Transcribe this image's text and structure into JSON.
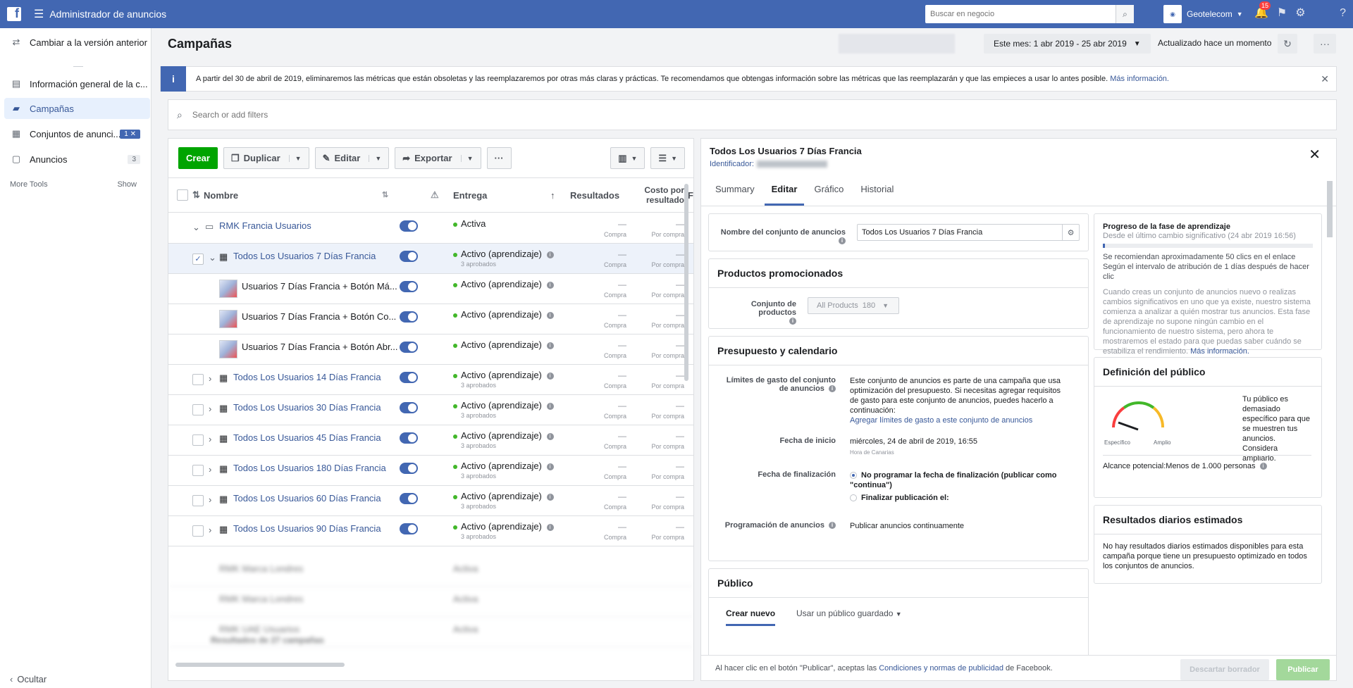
{
  "topbar": {
    "logo": "f",
    "title": "Administrador de anuncios",
    "search_placeholder": "Buscar en negocio",
    "account_name": "Geotelecom",
    "notification_count": "15"
  },
  "sidebar": {
    "items": [
      {
        "label": "Cambiar a la versión anterior",
        "icon": "swap-icon"
      },
      {
        "label": "Información general de la c...",
        "icon": "overview-icon"
      },
      {
        "label": "Campañas",
        "icon": "folder-icon"
      },
      {
        "label": "Conjuntos de anunci...",
        "icon": "grid-icon",
        "count": "1 ✕"
      },
      {
        "label": "Anuncios",
        "icon": "ad-icon",
        "count": "3"
      }
    ],
    "more_tools": "More Tools",
    "show": "Show",
    "hide": "Ocultar"
  },
  "header": {
    "title": "Campañas",
    "date_range": "Este mes: 1 abr 2019 - 25 abr 2019",
    "updated": "Actualizado hace un momento"
  },
  "notice": {
    "text": "A partir del 30 de abril de 2019, eliminaremos las métricas que están obsoletas y las reemplazaremos por otras más claras y prácticas. Te recomendamos que obtengas información sobre las métricas que las reemplazarán y que las empieces a usar lo antes posible.",
    "link": "Más información."
  },
  "filter": {
    "placeholder": "Search or add filters"
  },
  "toolbar": {
    "create": "Crear",
    "duplicate": "Duplicar",
    "edit": "Editar",
    "export": "Exportar",
    "more": "···"
  },
  "table": {
    "headers": {
      "name": "Nombre",
      "delivery": "Entrega",
      "results": "Resultados",
      "cost": "Costo por resultado",
      "extra": "F"
    },
    "result_label": "Compra",
    "cost_label": "Por compra",
    "dash": "—",
    "rows": [
      {
        "name": "RMK Francia Usuarios",
        "status": "Activa",
        "sub": "",
        "kind": "campaign"
      },
      {
        "name": "Todos Los Usuarios 7 Días Francia",
        "status": "Activo (aprendizaje)",
        "sub": "3 aprobados",
        "kind": "adset"
      },
      {
        "name": "Usuarios 7 Días Francia + Botón Má...",
        "status": "Activo (aprendizaje)",
        "sub": "",
        "kind": "ad"
      },
      {
        "name": "Usuarios 7 Días Francia + Botón Co...",
        "status": "Activo (aprendizaje)",
        "sub": "",
        "kind": "ad"
      },
      {
        "name": "Usuarios 7 Días Francia + Botón Abr...",
        "status": "Activo (aprendizaje)",
        "sub": "",
        "kind": "ad"
      },
      {
        "name": "Todos Los Usuarios 14 Días Francia",
        "status": "Activo (aprendizaje)",
        "sub": "3 aprobados",
        "kind": "adset"
      },
      {
        "name": "Todos Los Usuarios 30 Días Francia",
        "status": "Activo (aprendizaje)",
        "sub": "3 aprobados",
        "kind": "adset"
      },
      {
        "name": "Todos Los Usuarios 45 Días Francia",
        "status": "Activo (aprendizaje)",
        "sub": "3 aprobados",
        "kind": "adset"
      },
      {
        "name": "Todos Los Usuarios 180 Días Francia",
        "status": "Activo (aprendizaje)",
        "sub": "3 aprobados",
        "kind": "adset"
      },
      {
        "name": "Todos Los Usuarios 60 Días Francia",
        "status": "Activo (aprendizaje)",
        "sub": "3 aprobados",
        "kind": "adset"
      },
      {
        "name": "Todos Los Usuarios 90 Días Francia",
        "status": "Activo (aprendizaje)",
        "sub": "3 aprobados",
        "kind": "adset"
      }
    ],
    "blurred_rows": [
      {
        "name": "RMK Marca Londres",
        "status": "Activa"
      },
      {
        "name": "RMK Marca Londres",
        "status": "Activa"
      },
      {
        "name": "RMK UAE Usuarios",
        "status": "Activa"
      }
    ],
    "footer_partial": "Resultados de 27 campañas"
  },
  "editor": {
    "title": "Todos Los Usuarios 7 Días Francia",
    "id_label": "Identificador:",
    "tabs": [
      "Summary",
      "Editar",
      "Gráfico",
      "Historial"
    ],
    "adset_name_label": "Nombre del conjunto de anuncios",
    "adset_name_value": "Todos Los Usuarios 7 Días Francia",
    "products_title": "Productos promocionados",
    "product_set_label": "Conjunto de productos",
    "product_set_value": "All Products",
    "product_set_count": "180",
    "budget_title": "Presupuesto y calendario",
    "spend_limits_label": "Límites de gasto del conjunto de anuncios",
    "spend_limits_text": "Este conjunto de anuncios es parte de una campaña que usa optimización del presupuesto. Si necesitas agregar requisitos de gasto para este conjunto de anuncios, puedes hacerlo a continuación:",
    "spend_limits_link": "Agregar límites de gasto a este conjunto de anuncios",
    "start_label": "Fecha de inicio",
    "start_value": "miércoles, 24 de abril de 2019, 16:55",
    "start_tz": "Hora de Canarias",
    "end_label": "Fecha de finalización",
    "end_opt1": "No programar la fecha de finalización (publicar como \"continua\")",
    "end_opt2": "Finalizar publicación el:",
    "schedule_label": "Programación de anuncios",
    "schedule_value": "Publicar anuncios continuamente",
    "audience_title": "Público",
    "audience_tab1": "Crear nuevo",
    "audience_tab2": "Usar un público guardado",
    "footer_text_1": "Al hacer clic en el botón \"Publicar\", aceptas las",
    "footer_link": "Condiciones y normas de publicidad",
    "footer_text_2": "de Facebook.",
    "discard": "Descartar borrador",
    "publish": "Publicar"
  },
  "learning": {
    "title": "Progreso de la fase de aprendizaje",
    "since": "Desde el último cambio significativo (24 abr 2019 16:56)",
    "progress": 0.01,
    "rec": "Se recomiendan aproximadamente 50 clics en el enlace",
    "rec2": "Según el intervalo de atribución de 1 días después de hacer clic",
    "body": "Cuando creas un conjunto de anuncios nuevo o realizas cambios significativos en uno que ya existe, nuestro sistema comienza a analizar a quién mostrar tus anuncios. Esta fase de aprendizaje no supone ningún cambio en el funcionamiento de nuestro sistema, pero ahora te mostraremos el estado para que puedas saber cuándo se estabiliza el rendimiento.",
    "link": "Más información."
  },
  "audience_def": {
    "title": "Definición del público",
    "specific": "Específico",
    "broad": "Amplio",
    "message": "Tu público es demasiado específico para que se muestren tus anuncios. Considera ampliarlo.",
    "reach": "Alcance potencial:Menos de 1.000 personas"
  },
  "daily_results": {
    "title": "Resultados diarios estimados",
    "text": "No hay resultados diarios estimados disponibles para esta campaña porque tiene un presupuesto optimizado en todos los conjuntos de anuncios."
  }
}
